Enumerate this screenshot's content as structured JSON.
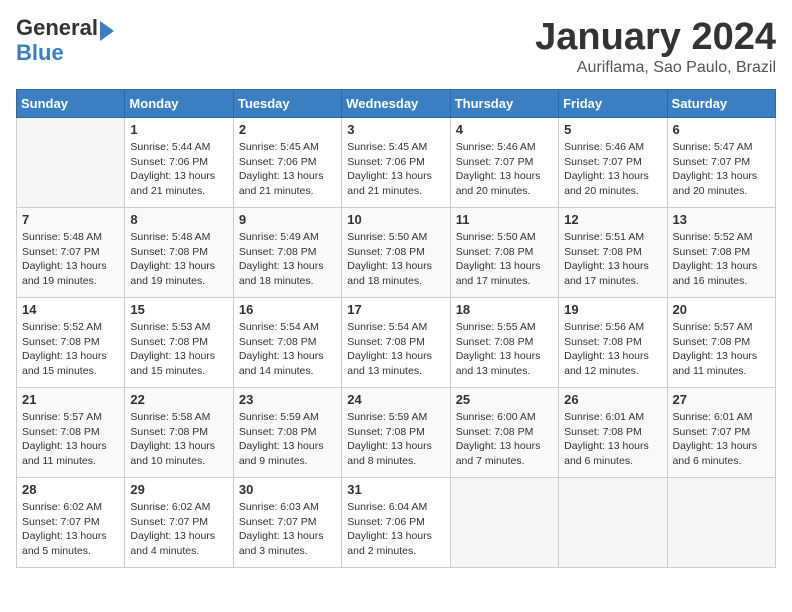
{
  "header": {
    "logo_general": "General",
    "logo_blue": "Blue",
    "title": "January 2024",
    "subtitle": "Auriflama, Sao Paulo, Brazil"
  },
  "weekdays": [
    "Sunday",
    "Monday",
    "Tuesday",
    "Wednesday",
    "Thursday",
    "Friday",
    "Saturday"
  ],
  "weeks": [
    [
      {
        "day": "",
        "info": ""
      },
      {
        "day": "1",
        "info": "Sunrise: 5:44 AM\nSunset: 7:06 PM\nDaylight: 13 hours\nand 21 minutes."
      },
      {
        "day": "2",
        "info": "Sunrise: 5:45 AM\nSunset: 7:06 PM\nDaylight: 13 hours\nand 21 minutes."
      },
      {
        "day": "3",
        "info": "Sunrise: 5:45 AM\nSunset: 7:06 PM\nDaylight: 13 hours\nand 21 minutes."
      },
      {
        "day": "4",
        "info": "Sunrise: 5:46 AM\nSunset: 7:07 PM\nDaylight: 13 hours\nand 20 minutes."
      },
      {
        "day": "5",
        "info": "Sunrise: 5:46 AM\nSunset: 7:07 PM\nDaylight: 13 hours\nand 20 minutes."
      },
      {
        "day": "6",
        "info": "Sunrise: 5:47 AM\nSunset: 7:07 PM\nDaylight: 13 hours\nand 20 minutes."
      }
    ],
    [
      {
        "day": "7",
        "info": "Sunrise: 5:48 AM\nSunset: 7:07 PM\nDaylight: 13 hours\nand 19 minutes."
      },
      {
        "day": "8",
        "info": "Sunrise: 5:48 AM\nSunset: 7:08 PM\nDaylight: 13 hours\nand 19 minutes."
      },
      {
        "day": "9",
        "info": "Sunrise: 5:49 AM\nSunset: 7:08 PM\nDaylight: 13 hours\nand 18 minutes."
      },
      {
        "day": "10",
        "info": "Sunrise: 5:50 AM\nSunset: 7:08 PM\nDaylight: 13 hours\nand 18 minutes."
      },
      {
        "day": "11",
        "info": "Sunrise: 5:50 AM\nSunset: 7:08 PM\nDaylight: 13 hours\nand 17 minutes."
      },
      {
        "day": "12",
        "info": "Sunrise: 5:51 AM\nSunset: 7:08 PM\nDaylight: 13 hours\nand 17 minutes."
      },
      {
        "day": "13",
        "info": "Sunrise: 5:52 AM\nSunset: 7:08 PM\nDaylight: 13 hours\nand 16 minutes."
      }
    ],
    [
      {
        "day": "14",
        "info": "Sunrise: 5:52 AM\nSunset: 7:08 PM\nDaylight: 13 hours\nand 15 minutes."
      },
      {
        "day": "15",
        "info": "Sunrise: 5:53 AM\nSunset: 7:08 PM\nDaylight: 13 hours\nand 15 minutes."
      },
      {
        "day": "16",
        "info": "Sunrise: 5:54 AM\nSunset: 7:08 PM\nDaylight: 13 hours\nand 14 minutes."
      },
      {
        "day": "17",
        "info": "Sunrise: 5:54 AM\nSunset: 7:08 PM\nDaylight: 13 hours\nand 13 minutes."
      },
      {
        "day": "18",
        "info": "Sunrise: 5:55 AM\nSunset: 7:08 PM\nDaylight: 13 hours\nand 13 minutes."
      },
      {
        "day": "19",
        "info": "Sunrise: 5:56 AM\nSunset: 7:08 PM\nDaylight: 13 hours\nand 12 minutes."
      },
      {
        "day": "20",
        "info": "Sunrise: 5:57 AM\nSunset: 7:08 PM\nDaylight: 13 hours\nand 11 minutes."
      }
    ],
    [
      {
        "day": "21",
        "info": "Sunrise: 5:57 AM\nSunset: 7:08 PM\nDaylight: 13 hours\nand 11 minutes."
      },
      {
        "day": "22",
        "info": "Sunrise: 5:58 AM\nSunset: 7:08 PM\nDaylight: 13 hours\nand 10 minutes."
      },
      {
        "day": "23",
        "info": "Sunrise: 5:59 AM\nSunset: 7:08 PM\nDaylight: 13 hours\nand 9 minutes."
      },
      {
        "day": "24",
        "info": "Sunrise: 5:59 AM\nSunset: 7:08 PM\nDaylight: 13 hours\nand 8 minutes."
      },
      {
        "day": "25",
        "info": "Sunrise: 6:00 AM\nSunset: 7:08 PM\nDaylight: 13 hours\nand 7 minutes."
      },
      {
        "day": "26",
        "info": "Sunrise: 6:01 AM\nSunset: 7:08 PM\nDaylight: 13 hours\nand 6 minutes."
      },
      {
        "day": "27",
        "info": "Sunrise: 6:01 AM\nSunset: 7:07 PM\nDaylight: 13 hours\nand 6 minutes."
      }
    ],
    [
      {
        "day": "28",
        "info": "Sunrise: 6:02 AM\nSunset: 7:07 PM\nDaylight: 13 hours\nand 5 minutes."
      },
      {
        "day": "29",
        "info": "Sunrise: 6:02 AM\nSunset: 7:07 PM\nDaylight: 13 hours\nand 4 minutes."
      },
      {
        "day": "30",
        "info": "Sunrise: 6:03 AM\nSunset: 7:07 PM\nDaylight: 13 hours\nand 3 minutes."
      },
      {
        "day": "31",
        "info": "Sunrise: 6:04 AM\nSunset: 7:06 PM\nDaylight: 13 hours\nand 2 minutes."
      },
      {
        "day": "",
        "info": ""
      },
      {
        "day": "",
        "info": ""
      },
      {
        "day": "",
        "info": ""
      }
    ]
  ]
}
